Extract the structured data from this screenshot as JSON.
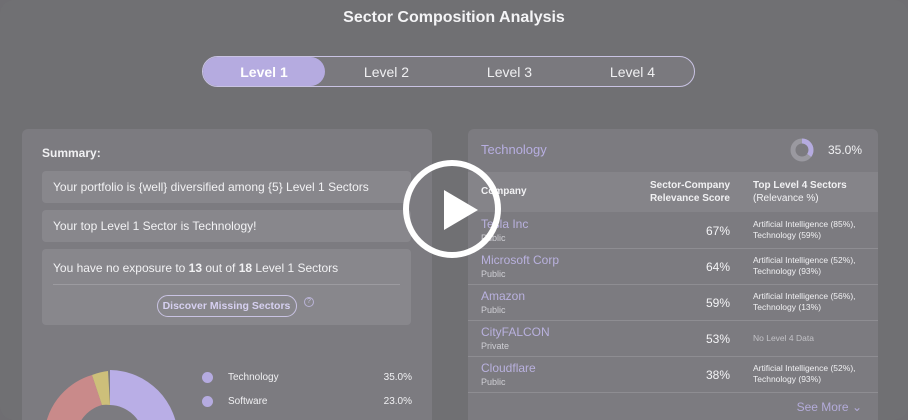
{
  "title": "Sector Composition Analysis",
  "tabs": [
    {
      "label": "Level 1",
      "active": true
    },
    {
      "label": "Level 2",
      "active": false
    },
    {
      "label": "Level 3",
      "active": false
    },
    {
      "label": "Level 4",
      "active": false
    }
  ],
  "summary": {
    "label": "Summary:",
    "line1": "Your portfolio is {well} diversified among {5} Level 1 Sectors",
    "line2": "Your top Level 1 Sector is Technology!",
    "line3_prefix": "You have no exposure to ",
    "line3_count": "13",
    "line3_mid": " out of ",
    "line3_total": "18",
    "line3_suffix": " Level 1 Sectors",
    "discover_label": "Discover Missing Sectors",
    "help_icon": "question-icon"
  },
  "legend": [
    {
      "name": "Technology",
      "pct": "35.0%",
      "color": "#b5abe0"
    },
    {
      "name": "Software",
      "pct": "23.0%",
      "color": "#b5abe0"
    }
  ],
  "donut_colors": [
    "#b9aee6",
    "#c98a8a",
    "#cdbf7a"
  ],
  "sector_panel": {
    "name": "Technology",
    "pct": "35.0%",
    "pct_value": 35.0,
    "accent": "#b5abe0",
    "col_company": "Company",
    "col_score_1": "Sector-Company",
    "col_score_2": "Relevance Score",
    "col_sectors_1": "Top Level 4 Sectors",
    "col_sectors_2": "(Relevance %)",
    "rows": [
      {
        "name": "Tesla Inc",
        "type": "Public",
        "score": "67%",
        "s1": "Artificial Intelligence (85%),",
        "s2": "Technology (59%)"
      },
      {
        "name": "Microsoft Corp",
        "type": "Public",
        "score": "64%",
        "s1": "Artificial Intelligence (52%),",
        "s2": "Technology (93%)"
      },
      {
        "name": "Amazon",
        "type": "Public",
        "score": "59%",
        "s1": "Artificial Intelligence (56%),",
        "s2": "Technology (13%)"
      },
      {
        "name": "CityFALCON",
        "type": "Private",
        "score": "53%",
        "s1": "No Level 4 Data",
        "s2": ""
      },
      {
        "name": "Cloudflare",
        "type": "Public",
        "score": "38%",
        "s1": "Artificial Intelligence (52%),",
        "s2": "Technology (93%)"
      }
    ],
    "see_more": "See More ⌄"
  }
}
